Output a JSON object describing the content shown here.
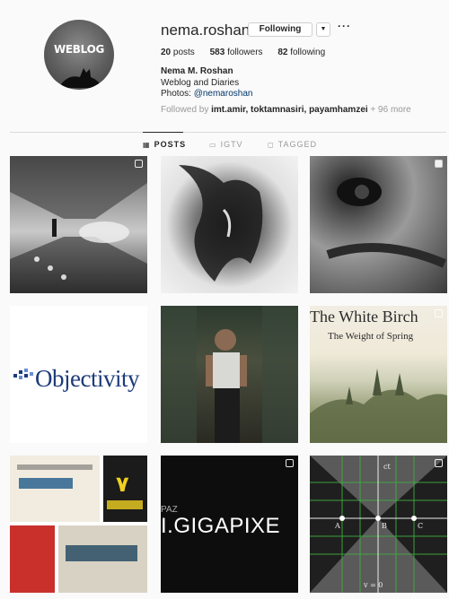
{
  "profile": {
    "avatar_text": "WEBLOG",
    "username": "nema.roshan",
    "follow_label": "Following",
    "dropdown_icon": "▼",
    "more_icon": "···",
    "stats": {
      "posts_count": "20",
      "posts_label": "posts",
      "followers_count": "583",
      "followers_label": "followers",
      "following_count": "82",
      "following_label": "following"
    },
    "full_name": "Nema M. Roshan",
    "bio": "Weblog and Diaries",
    "photos_prefix": "Photos: ",
    "photos_link": "@nemaroshan",
    "followed_prefix": "Followed by ",
    "followed_names": "imt.amir, toktamnasiri, payamhamzei",
    "followed_more": " + 96 more"
  },
  "tabs": [
    {
      "label": "POSTS",
      "icon": "grid-icon",
      "active": true
    },
    {
      "label": "IGTV",
      "icon": "tv-icon",
      "active": false
    },
    {
      "label": "TAGGED",
      "icon": "tag-icon",
      "active": false
    }
  ],
  "posts": [
    {
      "id": "post-1",
      "badge": true
    },
    {
      "id": "post-2",
      "badge": false
    },
    {
      "id": "post-3",
      "badge": true
    },
    {
      "id": "post-4",
      "text": "Objectivity",
      "badge": false
    },
    {
      "id": "post-5",
      "badge": false
    },
    {
      "id": "post-6",
      "title": "The White Birch",
      "subtitle": "The Weight of Spring",
      "badge": true
    },
    {
      "id": "post-7",
      "badge": false
    },
    {
      "id": "post-8",
      "text": "I.GIGAPIXE",
      "small_text": "PAZ",
      "badge": true
    },
    {
      "id": "post-9",
      "labels": [
        "A",
        "B",
        "C",
        "v = 0",
        "ct"
      ],
      "badge": true
    }
  ],
  "colors": {
    "link": "#003569",
    "muted": "#999999",
    "text": "#262626",
    "objectivity_blue": "#1d3b7a"
  }
}
